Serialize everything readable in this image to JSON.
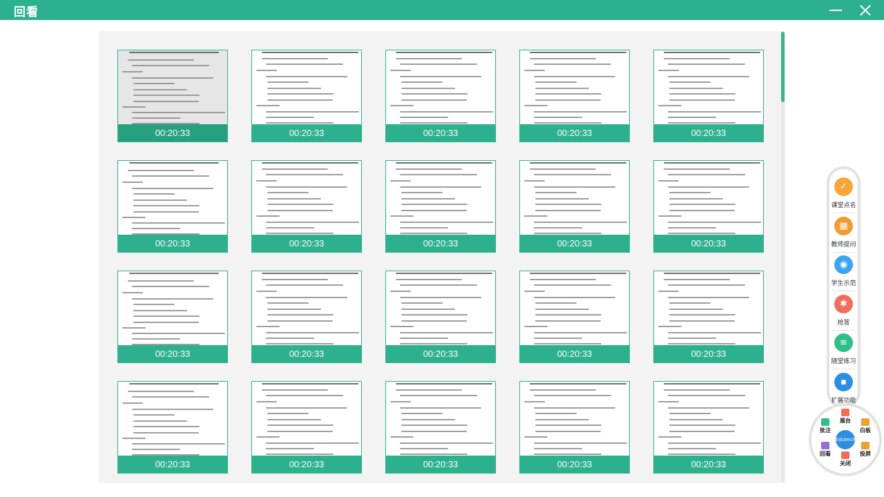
{
  "window": {
    "title": "回看"
  },
  "thumbnails": [
    {
      "time": "00:20:33",
      "selected": true
    },
    {
      "time": "00:20:33"
    },
    {
      "time": "00:20:33"
    },
    {
      "time": "00:20:33"
    },
    {
      "time": "00:20:33"
    },
    {
      "time": "00:20:33"
    },
    {
      "time": "00:20:33"
    },
    {
      "time": "00:20:33"
    },
    {
      "time": "00:20:33"
    },
    {
      "time": "00:20:33"
    },
    {
      "time": "00:20:33"
    },
    {
      "time": "00:20:33"
    },
    {
      "time": "00:20:33"
    },
    {
      "time": "00:20:33"
    },
    {
      "time": "00:20:33"
    },
    {
      "time": "00:20:33"
    },
    {
      "time": "00:20:33"
    },
    {
      "time": "00:20:33"
    },
    {
      "time": "00:20:33"
    },
    {
      "time": "00:20:33"
    }
  ],
  "toolbar": {
    "tools": [
      {
        "label": "课堂点名",
        "icon": "roll-call-icon",
        "color": "#f7a53a"
      },
      {
        "label": "教师提问",
        "icon": "teacher-question-icon",
        "color": "#f59a2e"
      },
      {
        "label": "学生示范",
        "icon": "student-demo-icon",
        "color": "#3aa6ef"
      },
      {
        "label": "抢答",
        "icon": "buzzer-icon",
        "color": "#f26d5b"
      },
      {
        "label": "随堂练习",
        "icon": "practice-icon",
        "color": "#2fbf86"
      },
      {
        "label": "扩展功能",
        "icon": "extensions-icon",
        "color": "#2d8fe0"
      }
    ]
  },
  "wheel": {
    "center": "Edutech",
    "items": [
      {
        "label": "展台",
        "icon": "booth-icon",
        "color": "#f26d5b"
      },
      {
        "label": "白板",
        "icon": "whiteboard-icon",
        "color": "#f0a030"
      },
      {
        "label": "投屏",
        "icon": "screen-cast-icon",
        "color": "#f0a030"
      },
      {
        "label": "关闭",
        "icon": "close-icon",
        "color": "#f26d5b"
      },
      {
        "label": "回看",
        "icon": "playback-icon",
        "color": "#9b6cd6"
      },
      {
        "label": "批注",
        "icon": "annotate-icon",
        "color": "#2fbf86"
      }
    ]
  }
}
